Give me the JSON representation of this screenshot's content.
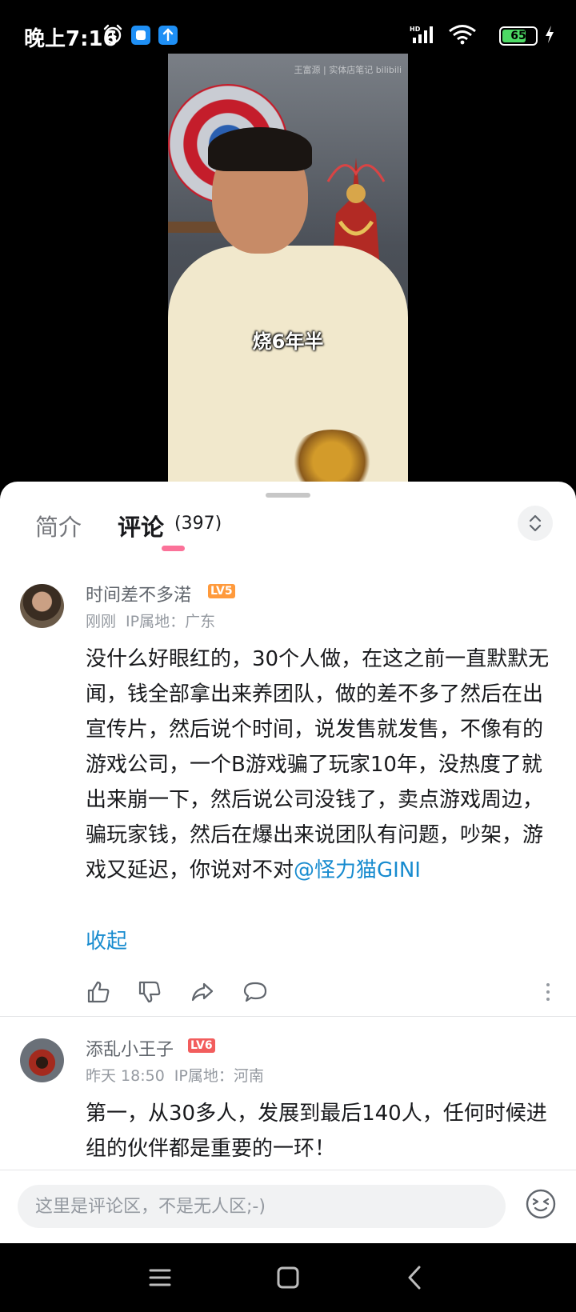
{
  "status_bar": {
    "time": "晚上7:16",
    "battery": "65",
    "icons": [
      "alarm-icon",
      "app-notification-icon",
      "upload-notification-icon",
      "hd-signal-icon",
      "wifi-icon",
      "battery-icon",
      "charging-icon"
    ]
  },
  "video": {
    "watermark": "王富源 | 实体店笔记 bilibili",
    "subtitle": "烧6年半"
  },
  "tabs": {
    "intro": "简介",
    "comments": "评论",
    "comment_count": "(397)"
  },
  "comments": [
    {
      "username": "时间差不多渃",
      "level": "LV5",
      "time": "刚刚",
      "ip": "IP属地：广东",
      "text": "没什么好眼红的，30个人做，在这之前一直默默无闻，钱全部拿出来养团队，做的差不多了然后在出宣传片，然后说个时间，说发售就发售，不像有的游戏公司，一个B游戏骗了玩家10年，没热度了就出来崩一下，然后说公司没钱了，卖点游戏周边，骗玩家钱，然后在爆出来说团队有问题，吵架，游戏又延迟，你说对不对",
      "mention": "@怪力猫GINI",
      "collapse": "收起"
    },
    {
      "username": "添乱小王子",
      "level": "LV6",
      "time": "昨天 18:50",
      "ip": "IP属地：河南",
      "text": "第一，从30多人，发展到最后140人，任何时候进组的伙伴都是重要的一环！"
    }
  ],
  "input": {
    "placeholder": "这里是评论区，不是无人区;-)"
  },
  "colors": {
    "accent": "#fb7299",
    "link": "#178bcf",
    "text": "#18191c",
    "secondary": "#9499a0"
  }
}
